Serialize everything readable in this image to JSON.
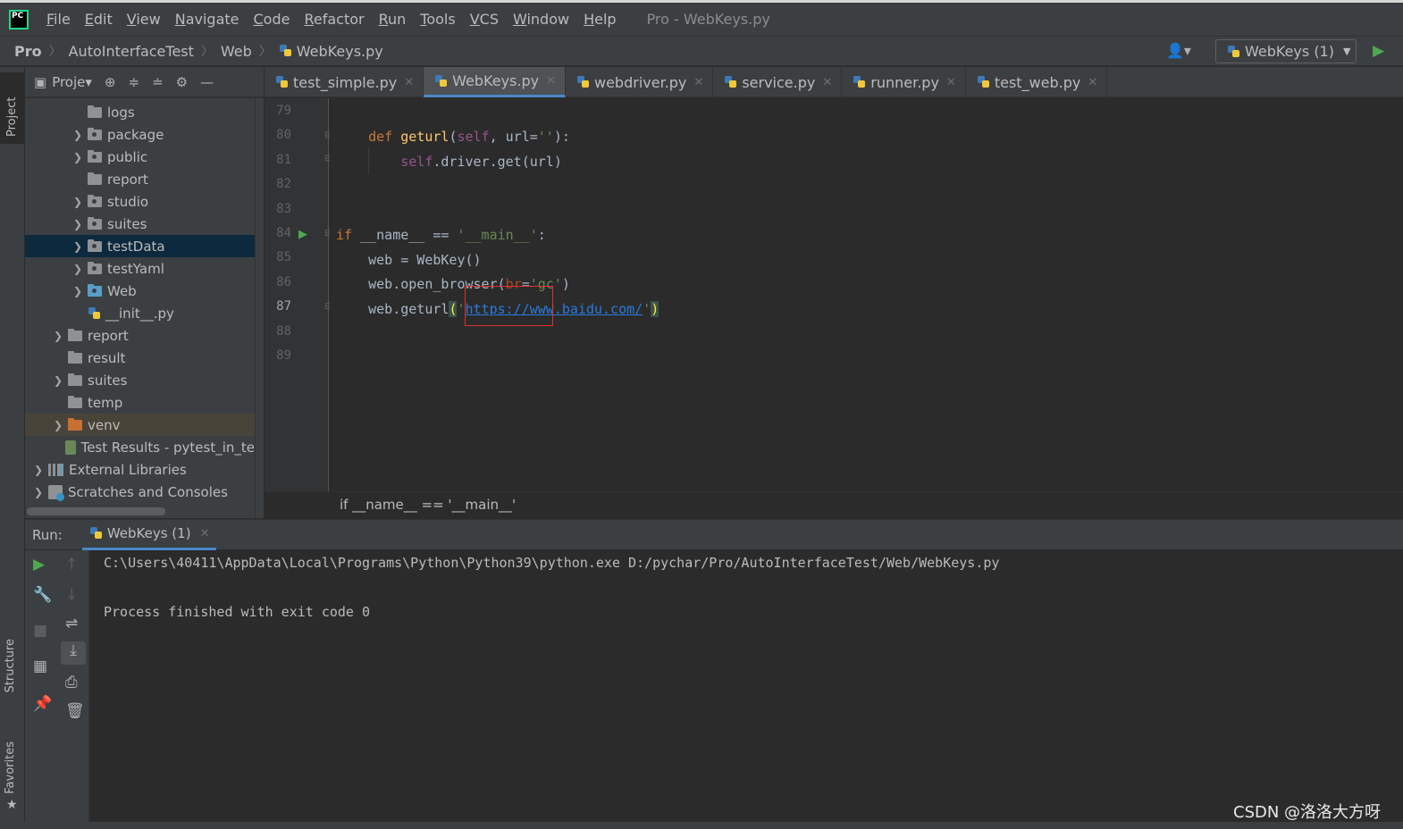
{
  "logo": "PC",
  "menu": [
    "File",
    "Edit",
    "View",
    "Navigate",
    "Code",
    "Refactor",
    "Run",
    "Tools",
    "VCS",
    "Window",
    "Help"
  ],
  "window_title": "Pro - WebKeys.py",
  "breadcrumbs": [
    "Pro",
    "AutoInterfaceTest",
    "Web",
    "WebKeys.py"
  ],
  "run_config": "WebKeys (1)",
  "left_strip": {
    "project": "Project",
    "structure": "Structure",
    "favorites": "Favorites"
  },
  "project_panel": {
    "title": "Proje"
  },
  "tree": [
    {
      "label": "logs",
      "indent": 2,
      "arrow": false,
      "icon": "folder"
    },
    {
      "label": "package",
      "indent": 2,
      "arrow": true,
      "icon": "pkg"
    },
    {
      "label": "public",
      "indent": 2,
      "arrow": true,
      "icon": "pkg"
    },
    {
      "label": "report",
      "indent": 2,
      "arrow": false,
      "icon": "folder"
    },
    {
      "label": "studio",
      "indent": 2,
      "arrow": true,
      "icon": "pkg"
    },
    {
      "label": "suites",
      "indent": 2,
      "arrow": true,
      "icon": "pkg"
    },
    {
      "label": "testData",
      "indent": 2,
      "arrow": true,
      "icon": "pkg",
      "state": "selected"
    },
    {
      "label": "testYaml",
      "indent": 2,
      "arrow": true,
      "icon": "pkg"
    },
    {
      "label": "Web",
      "indent": 2,
      "arrow": true,
      "icon": "blue"
    },
    {
      "label": "__init__.py",
      "indent": 2,
      "arrow": false,
      "icon": "py"
    },
    {
      "label": "report",
      "indent": 1,
      "arrow": true,
      "icon": "folder"
    },
    {
      "label": "result",
      "indent": 1,
      "arrow": false,
      "icon": "folder"
    },
    {
      "label": "suites",
      "indent": 1,
      "arrow": true,
      "icon": "folder"
    },
    {
      "label": "temp",
      "indent": 1,
      "arrow": false,
      "icon": "folder"
    },
    {
      "label": "venv",
      "indent": 1,
      "arrow": true,
      "icon": "orange",
      "state": "highlight"
    },
    {
      "label": "Test Results - pytest_in_te",
      "indent": 1,
      "arrow": false,
      "icon": "testres"
    },
    {
      "label": "External Libraries",
      "indent": 0,
      "arrow": true,
      "icon": "lib"
    },
    {
      "label": "Scratches and Consoles",
      "indent": 0,
      "arrow": true,
      "icon": "scratch"
    }
  ],
  "tabs": [
    {
      "label": "test_simple.py",
      "active": false
    },
    {
      "label": "WebKeys.py",
      "active": true
    },
    {
      "label": "webdriver.py",
      "active": false
    },
    {
      "label": "service.py",
      "active": false
    },
    {
      "label": "runner.py",
      "active": false
    },
    {
      "label": "test_web.py",
      "active": false
    }
  ],
  "line_numbers": [
    "79",
    "80",
    "81",
    "82",
    "83",
    "84",
    "85",
    "86",
    "87",
    "88",
    "89"
  ],
  "current_line": "87",
  "code": {
    "l80": {
      "kw": "def ",
      "fn": "geturl",
      "p1": "(",
      "self": "self",
      "p2": ", url=",
      "str": "''",
      "p3": "):"
    },
    "l81": {
      "self": "self",
      "rest": ".driver.get(url)"
    },
    "l84": {
      "kw": "if ",
      "rest": "__name__ == ",
      "str": "'__main__'",
      "end": ":"
    },
    "l85": {
      "text": "web = WebKey()"
    },
    "l86": {
      "a": "web.open_browser(",
      "param": "br",
      "eq": "=",
      "str": "'gc'",
      "end": ")"
    },
    "l87": {
      "a": "web.geturl",
      "lp": "(",
      "q1": "'",
      "url": "https://www.baidu.com/",
      "q2": "'",
      "rp": ")"
    }
  },
  "editor_breadcrumb": "if __name__ == '__main__'",
  "run_panel": {
    "label": "Run:",
    "tab": "WebKeys (1)",
    "console": [
      "C:\\Users\\40411\\AppData\\Local\\Programs\\Python\\Python39\\python.exe D:/pychar/Pro/AutoInterfaceTest/Web/WebKeys.py",
      "",
      "Process finished with exit code 0"
    ]
  },
  "watermark": "CSDN @洛洛大方呀",
  "colors": {
    "keyword": "#cc7832",
    "function": "#ffc66d",
    "string": "#6a8759",
    "self": "#94558d",
    "accent": "#4a88c7",
    "run_green": "#4fa852"
  }
}
